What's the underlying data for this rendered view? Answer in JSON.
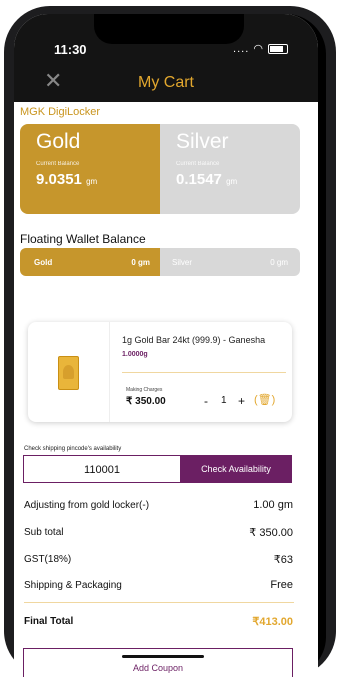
{
  "status_bar": {
    "time": "11:30",
    "signal": "....",
    "wifi": "wifi-icon",
    "battery": "battery-icon"
  },
  "header": {
    "title": "My Cart",
    "close_icon": "close-icon"
  },
  "locker": {
    "section_label": "MGK DigiLocker",
    "gold": {
      "title": "Gold",
      "sub": "Current Balance",
      "value": "9.0351",
      "unit": "gm"
    },
    "silver": {
      "title": "Silver",
      "sub": "Current Balance",
      "value": "0.1547",
      "unit": "gm"
    }
  },
  "floating_wallet": {
    "label": "Floating Wallet Balance",
    "gold_label": "Gold",
    "gold_value": "0 gm",
    "silver_label": "Silver",
    "silver_value": "0 gm"
  },
  "product": {
    "name": "1g Gold Bar 24kt (999.9) - Ganesha",
    "weight": "1.0000g",
    "making_label": "Making Charges",
    "making_value": "₹ 350.00",
    "qty_minus": "-",
    "qty": "1",
    "qty_plus": "+",
    "trash_icon": "(🗑)"
  },
  "pincode": {
    "label": "Check shipping pincode's availability",
    "value": "110001",
    "button": "Check Availability"
  },
  "summary": {
    "adjust_label": "Adjusting from gold locker(-)",
    "adjust_value": "1.00 gm",
    "subtotal_label": "Sub total",
    "subtotal_value": "₹ 350.00",
    "gst_label": "GST(18%)",
    "gst_value": "₹63",
    "shipping_label": "Shipping & Packaging",
    "shipping_value": "Free",
    "final_label": "Final Total",
    "final_value": "₹413.00"
  },
  "coupon": {
    "button": "Add Coupon"
  },
  "colors": {
    "gold": "#c6962c",
    "silver": "#d8d8d8",
    "accent": "#e2a72e",
    "purple": "#6b1f63",
    "topbar": "#141414"
  }
}
